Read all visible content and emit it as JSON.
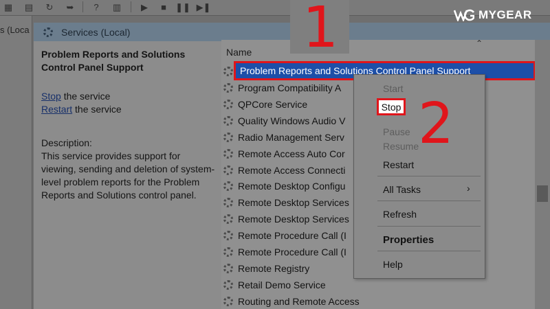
{
  "brand": {
    "logo_text": "MYGEAR"
  },
  "left_tree": {
    "label": "s (Loca"
  },
  "panel": {
    "title": "Services (Local)"
  },
  "details": {
    "service_title": "Problem Reports and Solutions Control Panel Support",
    "stop_link": "Stop",
    "stop_suffix": " the service",
    "restart_link": "Restart",
    "restart_suffix": " the service",
    "description_label": "Description:",
    "description_text": "This service provides support for viewing, sending and deletion of system-level problem reports for the Problem Reports and Solutions control panel."
  },
  "list": {
    "column_name": "Name",
    "selected_row": "Problem Reports and Solutions Control Panel Support",
    "rows": [
      "Program Compatibility A",
      "QPCore Service",
      "Quality Windows Audio V",
      "Radio Management Serv",
      "Remote Access Auto Cor",
      "Remote Access Connecti",
      "Remote Desktop Configu",
      "Remote Desktop Services",
      "Remote Desktop Services",
      "Remote Procedure Call (I",
      "Remote Procedure Call (I",
      "Remote Registry",
      "Retail Demo Service",
      "Routing and Remote Access"
    ]
  },
  "context_menu": {
    "start": "Start",
    "stop": "Stop",
    "pause": "Pause",
    "resume": "Resume",
    "restart": "Restart",
    "all_tasks": "All Tasks",
    "refresh": "Refresh",
    "properties": "Properties",
    "help": "Help",
    "submenu_arrow": "›"
  },
  "annotations": {
    "step1": "1",
    "step2": "2"
  },
  "colors": {
    "highlight_red": "#e0151b",
    "selection_blue": "#1d4fa8"
  }
}
